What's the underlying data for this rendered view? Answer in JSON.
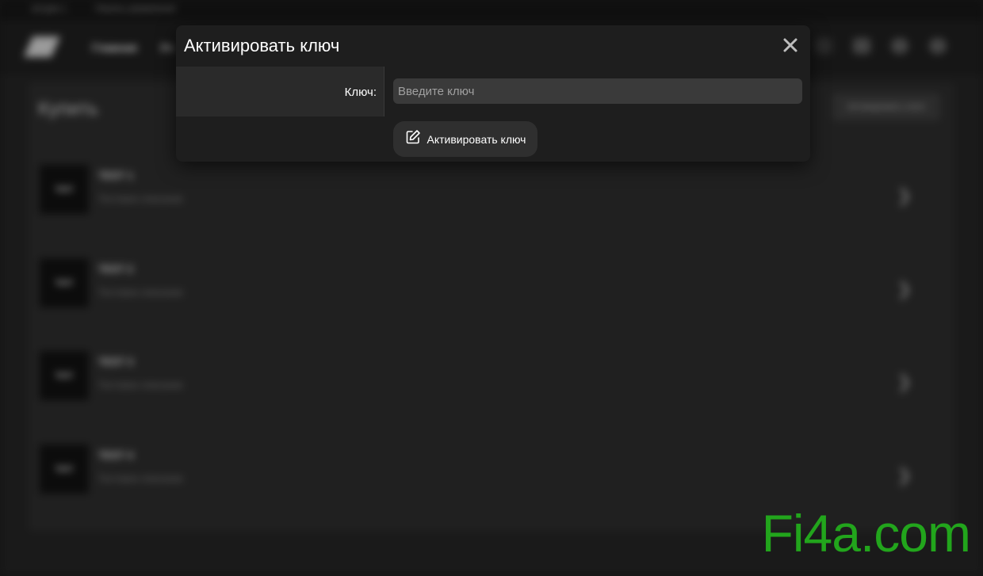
{
  "background": {
    "topbar": {
      "links": [
        "Штурм 1",
        "Панель управления"
      ]
    },
    "navbar": {
      "links": [
        "Главная",
        "Уч"
      ]
    },
    "panel": {
      "title": "Купить",
      "action_button": "Активировать ключ",
      "items": [
        {
          "thumb": "TEST",
          "title": "TEST 1",
          "desc": "Тестовое описание"
        },
        {
          "thumb": "TEST",
          "title": "TEST 2",
          "desc": "Тестовое описание"
        },
        {
          "thumb": "TEST",
          "title": "TEST 3",
          "desc": "Тестовое описание"
        },
        {
          "thumb": "TEST",
          "title": "TEST 4",
          "desc": "Тестовое описание"
        }
      ]
    }
  },
  "modal": {
    "title": "Активировать ключ",
    "close_icon": "close-icon",
    "key_label": "Ключ:",
    "key_input": {
      "value": "",
      "placeholder": "Введите ключ"
    },
    "submit": {
      "icon": "edit-icon",
      "label": "Активировать ключ"
    }
  },
  "watermark": "Fi4a.com",
  "colors": {
    "modal_bg": "#1e1e1e",
    "label_cell_bg": "#2a2a2a",
    "input_bg": "#3a3a3a",
    "button_bg": "#2f2f2f",
    "watermark": "#22a51c"
  }
}
